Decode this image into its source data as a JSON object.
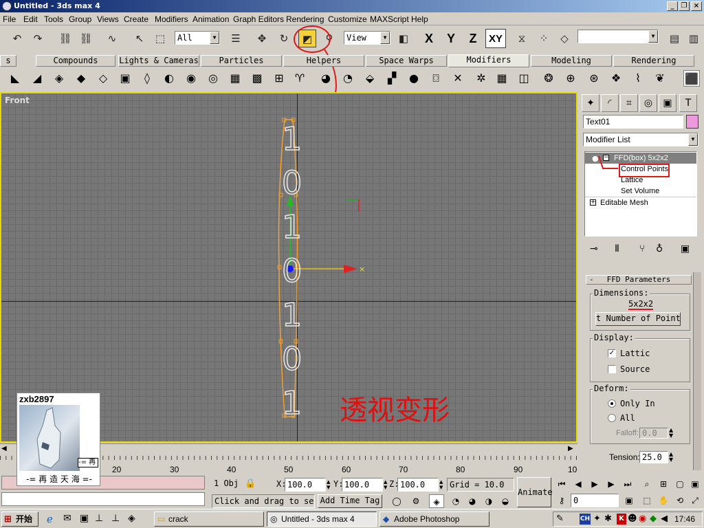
{
  "window": {
    "title": "Untitled - 3ds max 4"
  },
  "menu": [
    "File",
    "Edit",
    "Tools",
    "Group",
    "Views",
    "Create",
    "Modifiers",
    "Animation",
    "Graph Editors",
    "Rendering",
    "Customize",
    "MAXScript",
    "Help"
  ],
  "toolbar": {
    "selection_filter": "All",
    "ref_coord": "View",
    "axes": [
      "X",
      "Y",
      "Z",
      "XY"
    ]
  },
  "tabs": [
    {
      "label": "s"
    },
    {
      "label": "Compounds"
    },
    {
      "label": "Lights & Cameras"
    },
    {
      "label": "Particles"
    },
    {
      "label": "Helpers"
    },
    {
      "label": "Space Warps"
    },
    {
      "label": "Modifiers"
    },
    {
      "label": "Modeling"
    },
    {
      "label": "Rendering"
    }
  ],
  "viewport": {
    "label": "Front",
    "overlay_text": "透视变形",
    "text_glyphs": [
      "1",
      "0",
      "1",
      "0",
      "1",
      "0",
      "1"
    ]
  },
  "panel": {
    "object_name": "Text01",
    "object_color": "#ee99dd",
    "modifier_list": "Modifier List",
    "stack": [
      "FFD(box) 5x2x2",
      "Control Points",
      "Lattice",
      "Set Volume",
      "Editable Mesh"
    ],
    "rollout_title": "FFD Parameters",
    "dimensions_label": "Dimensions:",
    "dimensions_value": "5x2x2",
    "set_points_button": "t Number of Point",
    "display_label": "Display:",
    "lattice_label": "Lattic",
    "source_label": "Source",
    "deform_label": "Deform:",
    "only_in_label": "Only In",
    "all_label": "All",
    "falloff_label": "Falloff:",
    "falloff_value": "0.0",
    "tension_label": "Tension:",
    "tension_value": "25.0"
  },
  "ruler": {
    "ticks": [
      "20",
      "30",
      "40",
      "50",
      "60",
      "70",
      "80",
      "90",
      "10"
    ]
  },
  "status": {
    "selection": "1 Obj",
    "x_label": "X:",
    "x": "100.0",
    "y_label": "Y:",
    "y": "100.0",
    "z_label": "Z:",
    "z": "100.0",
    "grid": "Grid = 10.0",
    "prompt": "Click and drag to sel",
    "add_time_tag": "Add Time Tag",
    "animate": "Animate",
    "frame": "0"
  },
  "thumbnail": {
    "user": "zxb2897",
    "caption": "-= 再 造 天 海 =-",
    "side": "-= 再"
  },
  "taskbar": {
    "start": "开始",
    "tasks": [
      "crack",
      "Untitled - 3ds max 4",
      "Adobe Photoshop"
    ],
    "clock": "17:46",
    "tray_ch": "CH"
  }
}
